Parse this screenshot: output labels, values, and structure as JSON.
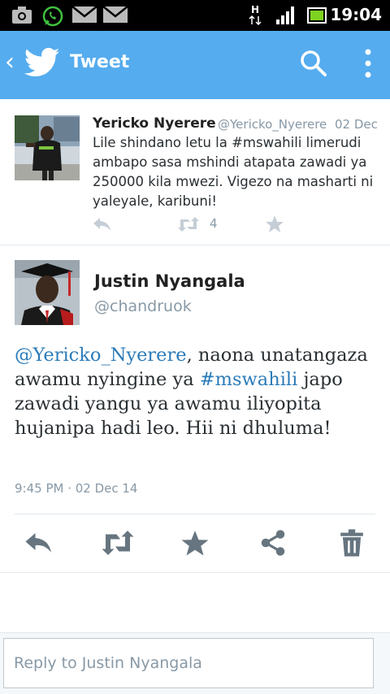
{
  "status_bar": {
    "time": "19:04",
    "network": "H",
    "icons": [
      "screenshot-icon",
      "whatsapp-icon",
      "gmail-icon",
      "gmail-icon",
      "network-h-icon",
      "signal-icon",
      "battery-icon"
    ]
  },
  "action_bar": {
    "title": "Tweet",
    "icons": [
      "back-icon",
      "twitter-bird-icon",
      "search-icon",
      "overflow-menu-icon"
    ]
  },
  "context_tweet": {
    "name": "Yericko Nyerere",
    "handle": "@Yericko_Nyerere",
    "date": "02 Dec",
    "text": "Lile shindano letu la #mswahili  limerudi ambapo sasa mshindi atapata zawadi ya 250000 kila mwezi. Vigezo na masharti ni yaleyale, karibuni!",
    "retweet_count": "4"
  },
  "main_tweet": {
    "name": "Justin Nyangala",
    "handle": "@chandruok",
    "mention": "@Yericko_Nyerere",
    "text_1": ", naona unatangaza awamu nyingine ya ",
    "hashtag": "#mswahili",
    "text_2": " japo zawadi yangu ya awamu iliyopita hujanipa hadi leo. Hii ni dhuluma!",
    "meta": "9:45 PM · 02 Dec 14",
    "actions": [
      "reply-icon",
      "retweet-icon",
      "favorite-icon",
      "share-icon",
      "delete-icon"
    ]
  },
  "reply_box": {
    "placeholder": "Reply to Justin Nyangala"
  },
  "colors": {
    "brand": "#55acee",
    "link": "#2b7bb9",
    "muted": "#8899a6",
    "icon_gray": "#8899a6"
  }
}
